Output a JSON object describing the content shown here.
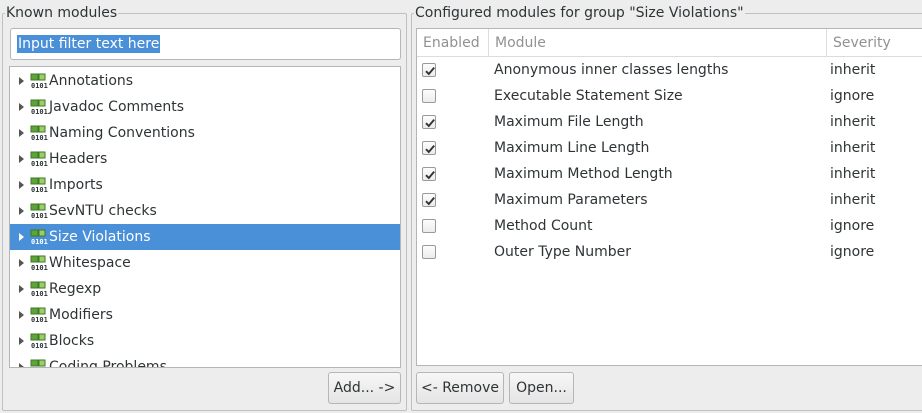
{
  "known": {
    "title": "Known modules",
    "filter_value": "Input filter text here",
    "items": [
      {
        "label": "Annotations",
        "selected": false
      },
      {
        "label": "Javadoc Comments",
        "selected": false
      },
      {
        "label": "Naming Conventions",
        "selected": false
      },
      {
        "label": "Headers",
        "selected": false
      },
      {
        "label": "Imports",
        "selected": false
      },
      {
        "label": "SevNTU checks",
        "selected": false
      },
      {
        "label": "Size Violations",
        "selected": true
      },
      {
        "label": "Whitespace",
        "selected": false
      },
      {
        "label": "Regexp",
        "selected": false
      },
      {
        "label": "Modifiers",
        "selected": false
      },
      {
        "label": "Blocks",
        "selected": false
      },
      {
        "label": "Coding Problems",
        "selected": false
      }
    ],
    "add_button": "Add... ->"
  },
  "configured": {
    "title": "Configured modules for group \"Size Violations\"",
    "columns": {
      "enabled": "Enabled",
      "module": "Module",
      "severity": "Severity"
    },
    "rows": [
      {
        "enabled": true,
        "module": "Anonymous inner classes lengths",
        "severity": "inherit"
      },
      {
        "enabled": false,
        "module": "Executable Statement Size",
        "severity": "ignore"
      },
      {
        "enabled": true,
        "module": "Maximum File Length",
        "severity": "inherit"
      },
      {
        "enabled": true,
        "module": "Maximum Line Length",
        "severity": "inherit"
      },
      {
        "enabled": true,
        "module": "Maximum Method Length",
        "severity": "inherit"
      },
      {
        "enabled": true,
        "module": "Maximum Parameters",
        "severity": "inherit"
      },
      {
        "enabled": false,
        "module": "Method Count",
        "severity": "ignore"
      },
      {
        "enabled": false,
        "module": "Outer Type Number",
        "severity": "ignore"
      }
    ],
    "remove_button": "<- Remove",
    "open_button": "Open..."
  },
  "colors": {
    "selection": "#4a90d9",
    "header_text": "#919191"
  },
  "icons": {
    "module": "module-binary-icon",
    "expander": "expander-arrow-icon",
    "check": "checkmark-icon"
  }
}
